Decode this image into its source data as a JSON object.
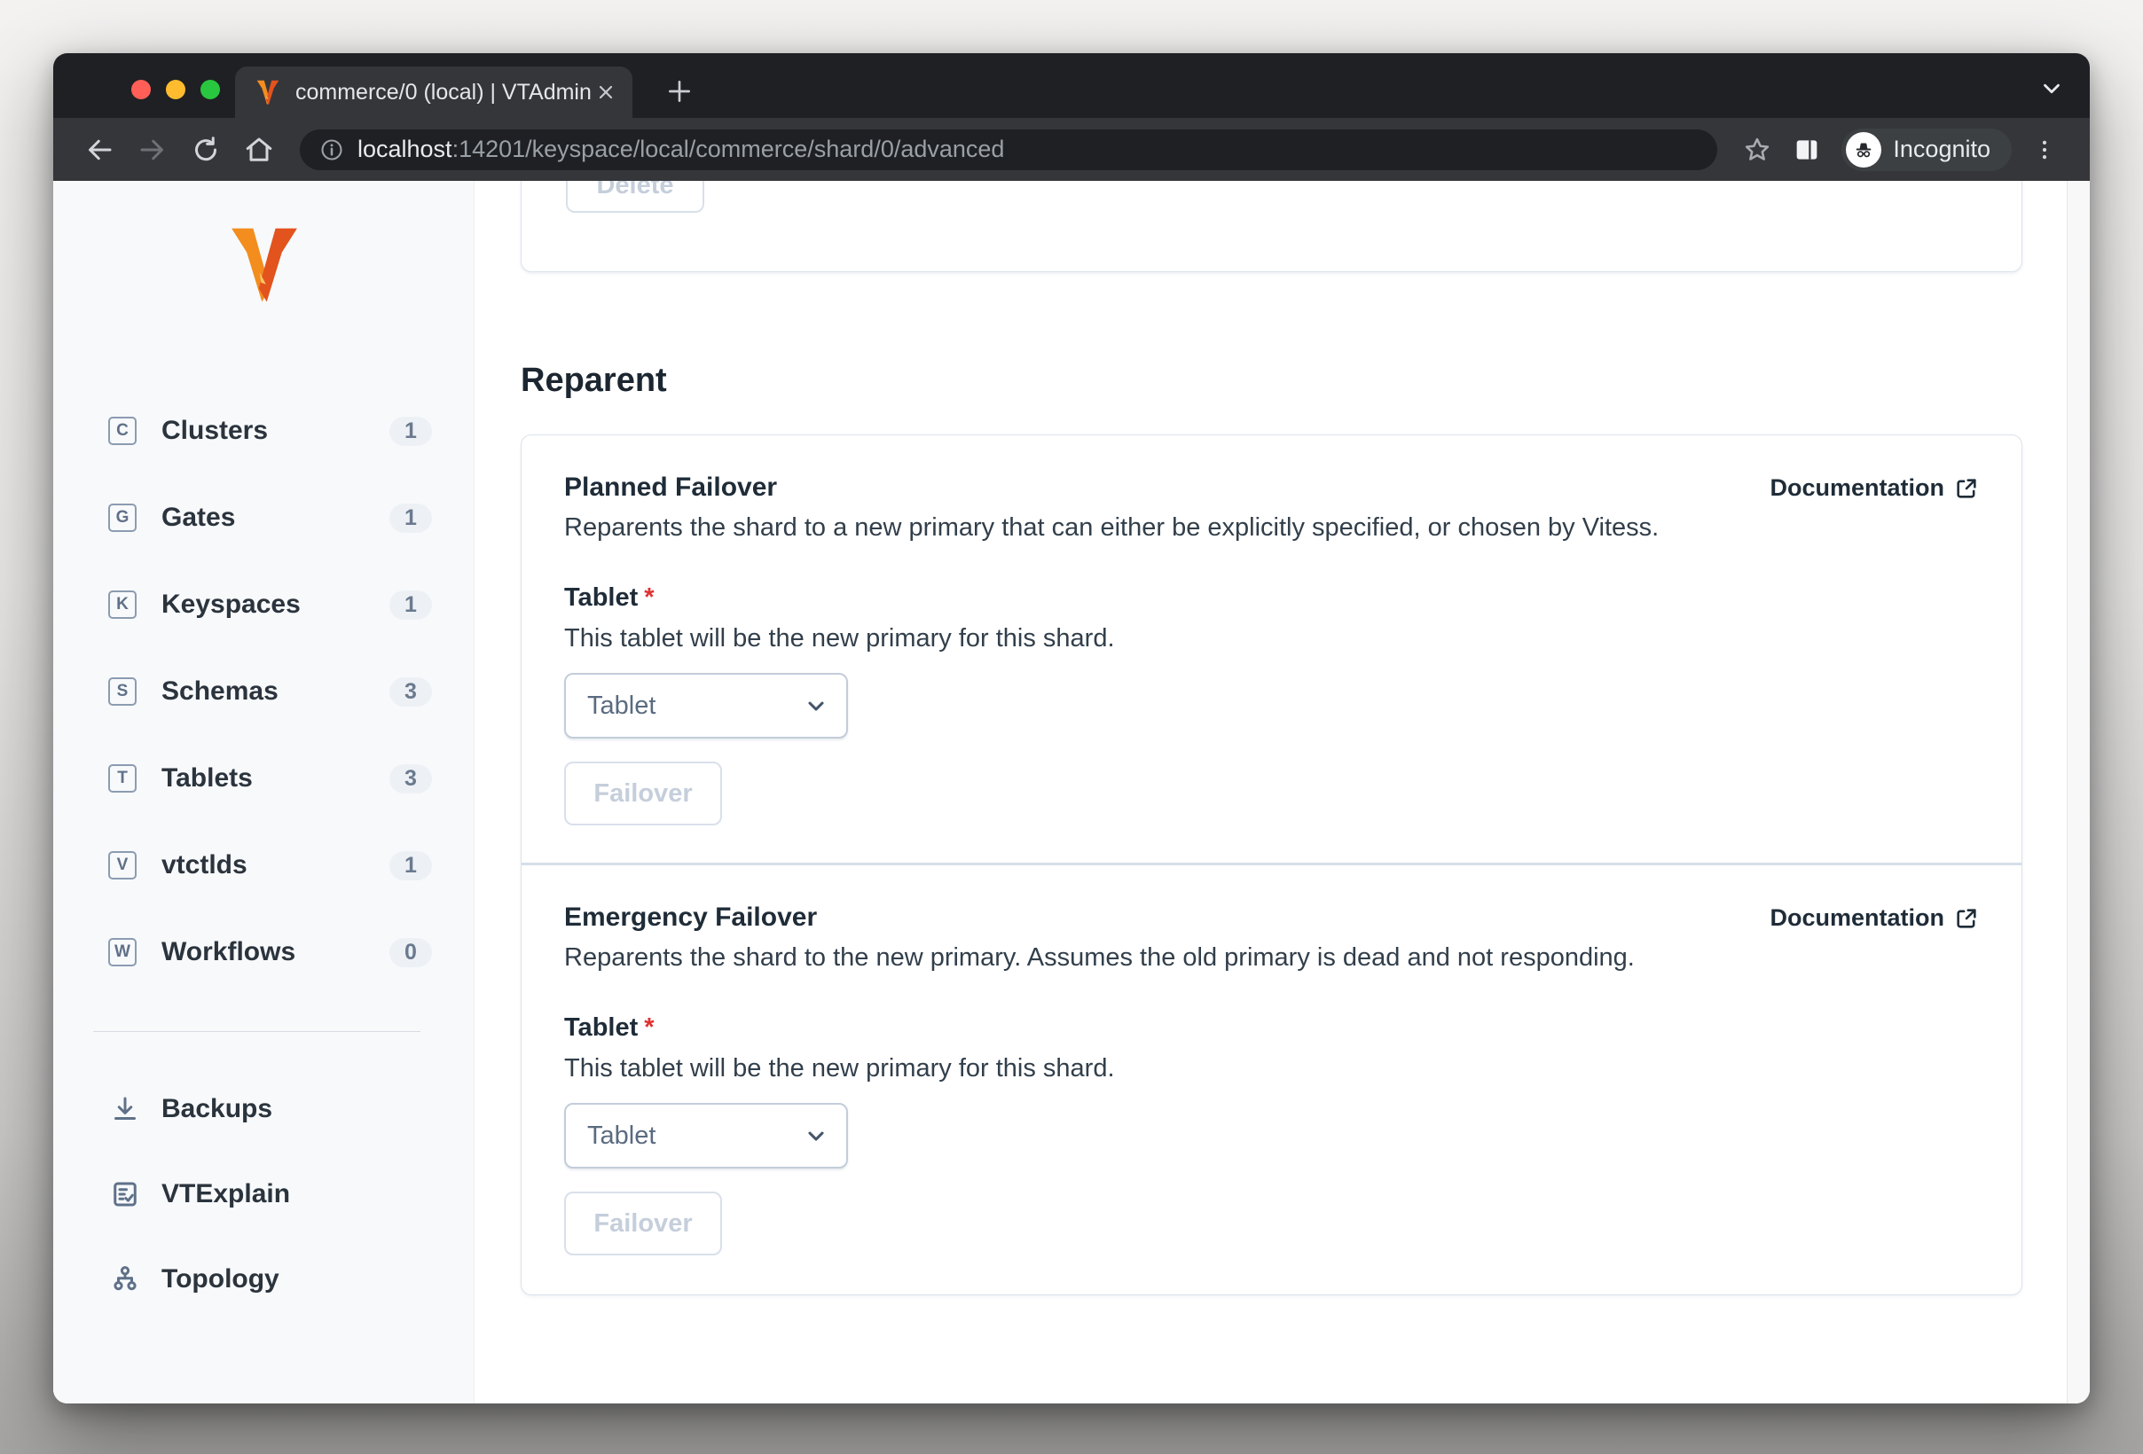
{
  "browser": {
    "tab_title": "commerce/0 (local) | VTAdmin",
    "url_host": "localhost",
    "url_rest": ":14201/keyspace/local/commerce/shard/0/advanced",
    "incognito_label": "Incognito"
  },
  "sidebar": {
    "items": [
      {
        "letter": "C",
        "label": "Clusters",
        "count": 1
      },
      {
        "letter": "G",
        "label": "Gates",
        "count": 1
      },
      {
        "letter": "K",
        "label": "Keyspaces",
        "count": 1
      },
      {
        "letter": "S",
        "label": "Schemas",
        "count": 3
      },
      {
        "letter": "T",
        "label": "Tablets",
        "count": 3
      },
      {
        "letter": "V",
        "label": "vtctlds",
        "count": 1
      },
      {
        "letter": "W",
        "label": "Workflows",
        "count": 0
      }
    ],
    "tools": [
      {
        "icon": "download-icon",
        "label": "Backups"
      },
      {
        "icon": "document-check-icon",
        "label": "VTExplain"
      },
      {
        "icon": "topology-tree-icon",
        "label": "Topology"
      }
    ]
  },
  "main": {
    "top_card": {
      "delete_label": "Delete"
    },
    "section_title": "Reparent",
    "cards": [
      {
        "title": "Planned Failover",
        "doc_label": "Documentation",
        "description": "Reparents the shard to a new primary that can either be explicitly specified, or chosen by Vitess.",
        "field_label": "Tablet",
        "required_mark": "*",
        "field_help": "This tablet will be the new primary for this shard.",
        "select_value": "Tablet",
        "button_label": "Failover"
      },
      {
        "title": "Emergency Failover",
        "doc_label": "Documentation",
        "description": "Reparents the shard to the new primary. Assumes the old primary is dead and not responding.",
        "field_label": "Tablet",
        "required_mark": "*",
        "field_help": "This tablet will be the new primary for this shard.",
        "select_value": "Tablet",
        "button_label": "Failover"
      }
    ]
  },
  "colors": {
    "brand_orange": "#f28d1e",
    "heading": "#1f2c38",
    "danger": "#e03131",
    "slate": "#5f7189",
    "disabled_text": "#c5cedb"
  }
}
